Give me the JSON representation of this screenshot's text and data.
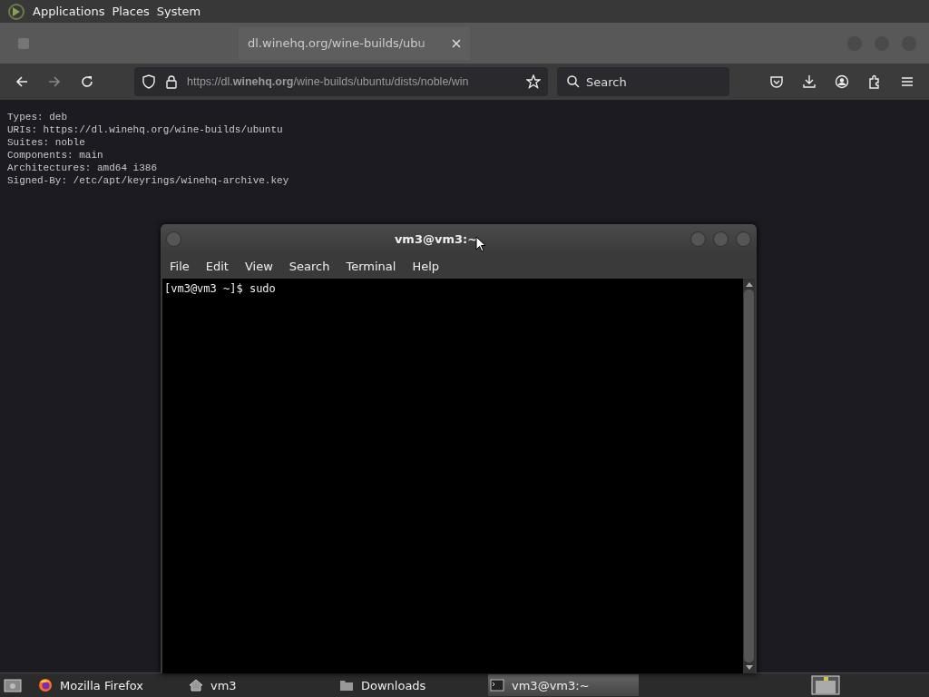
{
  "top_panel": {
    "menus": [
      "Applications",
      "Places",
      "System"
    ]
  },
  "browser": {
    "tabs": [
      {
        "selected": false
      },
      {
        "title": "dl.winehq.org/wine-builds/ubu",
        "selected": true
      }
    ],
    "url": "https://dl.**winehq.org**/wine-builds/ubuntu/dists/noble/win",
    "search": {
      "placeholder": "Search"
    },
    "page_lines": [
      "Types: deb",
      "URIs: https://dl.winehq.org/wine-builds/ubuntu",
      "Suites: noble",
      "Components: main",
      "Architectures: amd64 i386",
      "Signed-By: /etc/apt/keyrings/winehq-archive.key"
    ]
  },
  "terminal": {
    "title": "vm3@vm3:~",
    "menu": [
      "File",
      "Edit",
      "View",
      "Search",
      "Terminal",
      "Help"
    ],
    "lines": [
      "[vm3@vm3 ~]$ sudo"
    ]
  },
  "taskbar": {
    "items": [
      {
        "label": "Mozilla Firefox",
        "kind": "firefox",
        "selected": false
      },
      {
        "label": "vm3",
        "kind": "home",
        "selected": false
      },
      {
        "label": "Downloads",
        "kind": "folder",
        "selected": false
      },
      {
        "label": "vm3@vm3:~",
        "kind": "terminal",
        "selected": true
      }
    ]
  }
}
